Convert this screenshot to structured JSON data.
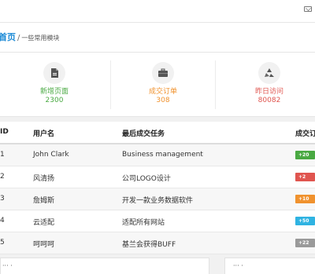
{
  "header": {
    "mail_icon": "mail-icon"
  },
  "breadcrumb": {
    "home": "首页",
    "separator": "/",
    "current": "一些常用模块"
  },
  "stats": [
    {
      "label": "新增页面",
      "value": "2300",
      "color": "#49a942",
      "icon": "document-icon"
    },
    {
      "label": "成交订单",
      "value": "308",
      "color": "#f0922e",
      "icon": "briefcase-icon"
    },
    {
      "label": "昨日访问",
      "value": "80082",
      "color": "#e0554f",
      "icon": "recycle-icon"
    }
  ],
  "table": {
    "headers": [
      "ID",
      "用户名",
      "最后成交任务",
      "成交订"
    ],
    "rows": [
      {
        "id": "1",
        "user": "John Clark",
        "task": "Business management",
        "badge": "+20",
        "badge_color": "#49a942"
      },
      {
        "id": "2",
        "user": "风清扬",
        "task": "公司LOGO设计",
        "badge": "+2",
        "badge_color": "#e0554f"
      },
      {
        "id": "3",
        "user": "詹姆斯",
        "task": "开发一款业务数据软件",
        "badge": "+10",
        "badge_color": "#f0922e"
      },
      {
        "id": "4",
        "user": "云适配",
        "task": "适配所有网站",
        "badge": "+50",
        "badge_color": "#2fb3e2"
      },
      {
        "id": "5",
        "user": "呵呵呵",
        "task": "基兰会获得BUFF",
        "badge": "+22",
        "badge_color": "#9a9a9a"
      }
    ]
  },
  "panels": [
    {
      "title": "··· ·"
    },
    {
      "title": "··· ·"
    }
  ]
}
